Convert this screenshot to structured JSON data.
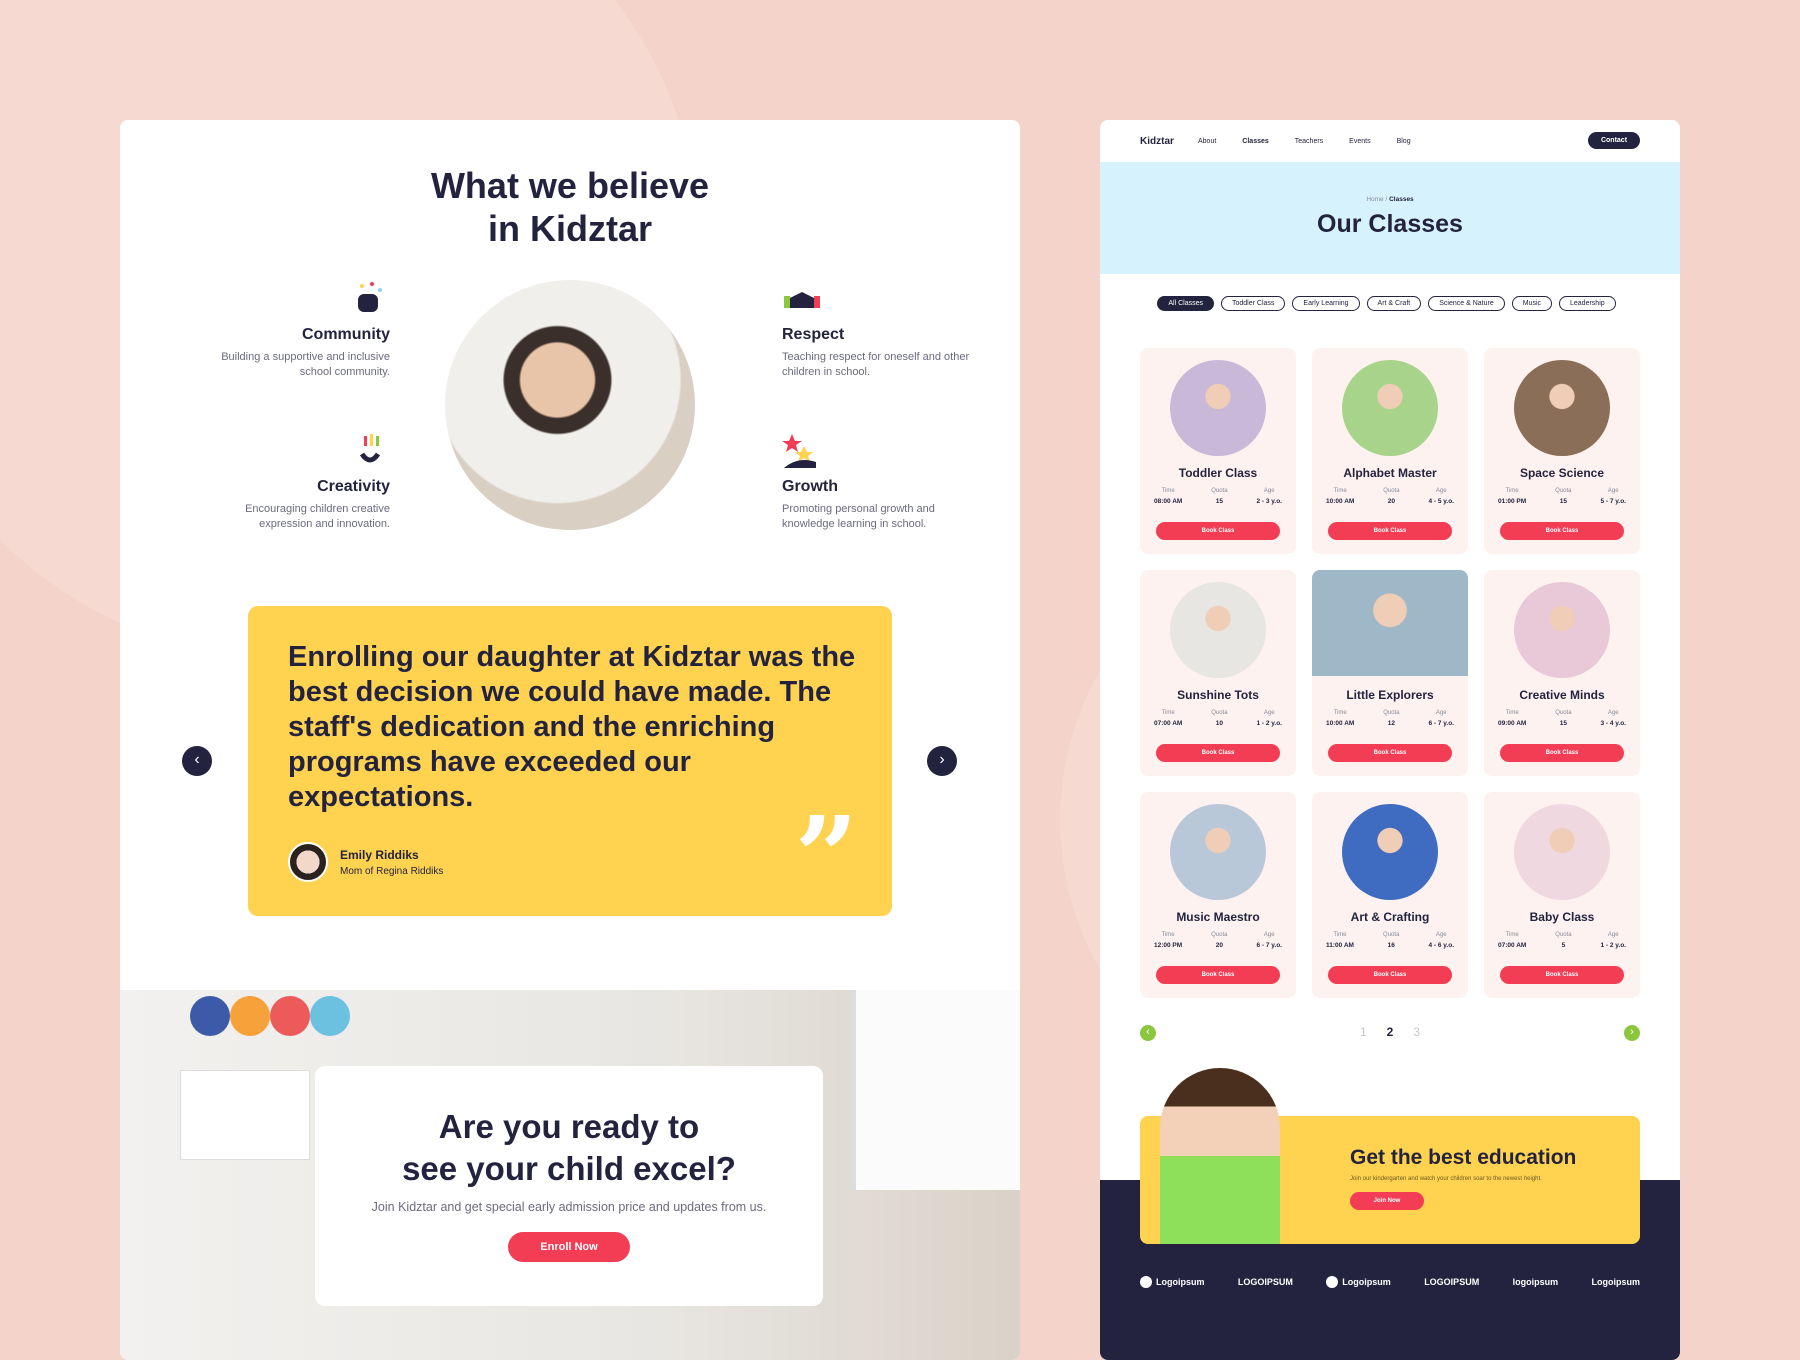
{
  "left": {
    "title_line1": "What we believe",
    "title_line2": "in Kidztar",
    "beliefs": [
      {
        "title": "Community",
        "desc": "Building a supportive and inclusive school community.",
        "icon": "community-icon"
      },
      {
        "title": "Respect",
        "desc": "Teaching respect for oneself and other children in school.",
        "icon": "respect-icon"
      },
      {
        "title": "Creativity",
        "desc": "Encouraging children creative expression and innovation.",
        "icon": "creativity-icon"
      },
      {
        "title": "Growth",
        "desc": "Promoting personal growth and knowledge learning in school.",
        "icon": "growth-icon"
      }
    ],
    "testimonial": {
      "quote": "Enrolling our daughter at Kidztar was the best decision we could have made. The staff's dedication and the enriching programs have exceeded our expectations.",
      "name": "Emily Riddiks",
      "role": "Mom of Regina Riddiks",
      "prev": "‹",
      "next": "›",
      "quote_mark": "”"
    },
    "cta": {
      "title_line1": "Are you ready to",
      "title_line2": "see your child excel?",
      "subtitle": "Join Kidztar and get special early admission price and updates from us.",
      "button": "Enroll Now"
    }
  },
  "right": {
    "logo": "Kidztar",
    "nav": [
      "About",
      "Classes",
      "Teachers",
      "Events",
      "Blog"
    ],
    "active_nav": "Classes",
    "contact": "Contact",
    "breadcrumb": {
      "home": "Home",
      "sep": "/",
      "current": "Classes"
    },
    "page_title": "Our Classes",
    "filters": [
      "All Classes",
      "Toddler Class",
      "Early Learning",
      "Art & Craft",
      "Science & Nature",
      "Music",
      "Leadership"
    ],
    "labels": {
      "time": "Time",
      "quota": "Quota",
      "age": "Age",
      "book": "Book Class"
    },
    "classes": [
      {
        "name": "Toddler Class",
        "time": "08:00 AM",
        "quota": "15",
        "age": "2 - 3 y.o."
      },
      {
        "name": "Alphabet Master",
        "time": "10:00 AM",
        "quota": "20",
        "age": "4 - 5 y.o."
      },
      {
        "name": "Space Science",
        "time": "01:00 PM",
        "quota": "15",
        "age": "5 - 7 y.o."
      },
      {
        "name": "Sunshine Tots",
        "time": "07:00 AM",
        "quota": "10",
        "age": "1 - 2 y.o."
      },
      {
        "name": "Little Explorers",
        "time": "10:00 AM",
        "quota": "12",
        "age": "6 - 7 y.o."
      },
      {
        "name": "Creative Minds",
        "time": "09:00 AM",
        "quota": "15",
        "age": "3 - 4 y.o."
      },
      {
        "name": "Music Maestro",
        "time": "12:00 PM",
        "quota": "20",
        "age": "6 - 7 y.o."
      },
      {
        "name": "Art & Crafting",
        "time": "11:00 AM",
        "quota": "16",
        "age": "4 - 6 y.o."
      },
      {
        "name": "Baby Class",
        "time": "07:00 AM",
        "quota": "5",
        "age": "1 - 2 y.o."
      }
    ],
    "pagination": {
      "pages": [
        "1",
        "2",
        "3"
      ],
      "current": "2",
      "prev": "‹",
      "next": "›"
    },
    "banner": {
      "title": "Get the best education",
      "subtitle": "Join our kindergarten and watch your children soar to the newest height.",
      "button": "Join Now"
    },
    "partners": [
      "Logoipsum",
      "LOGOIPSUM",
      "Logoipsum",
      "LOGOIPSUM",
      "logoipsum",
      "Logoipsum"
    ]
  }
}
